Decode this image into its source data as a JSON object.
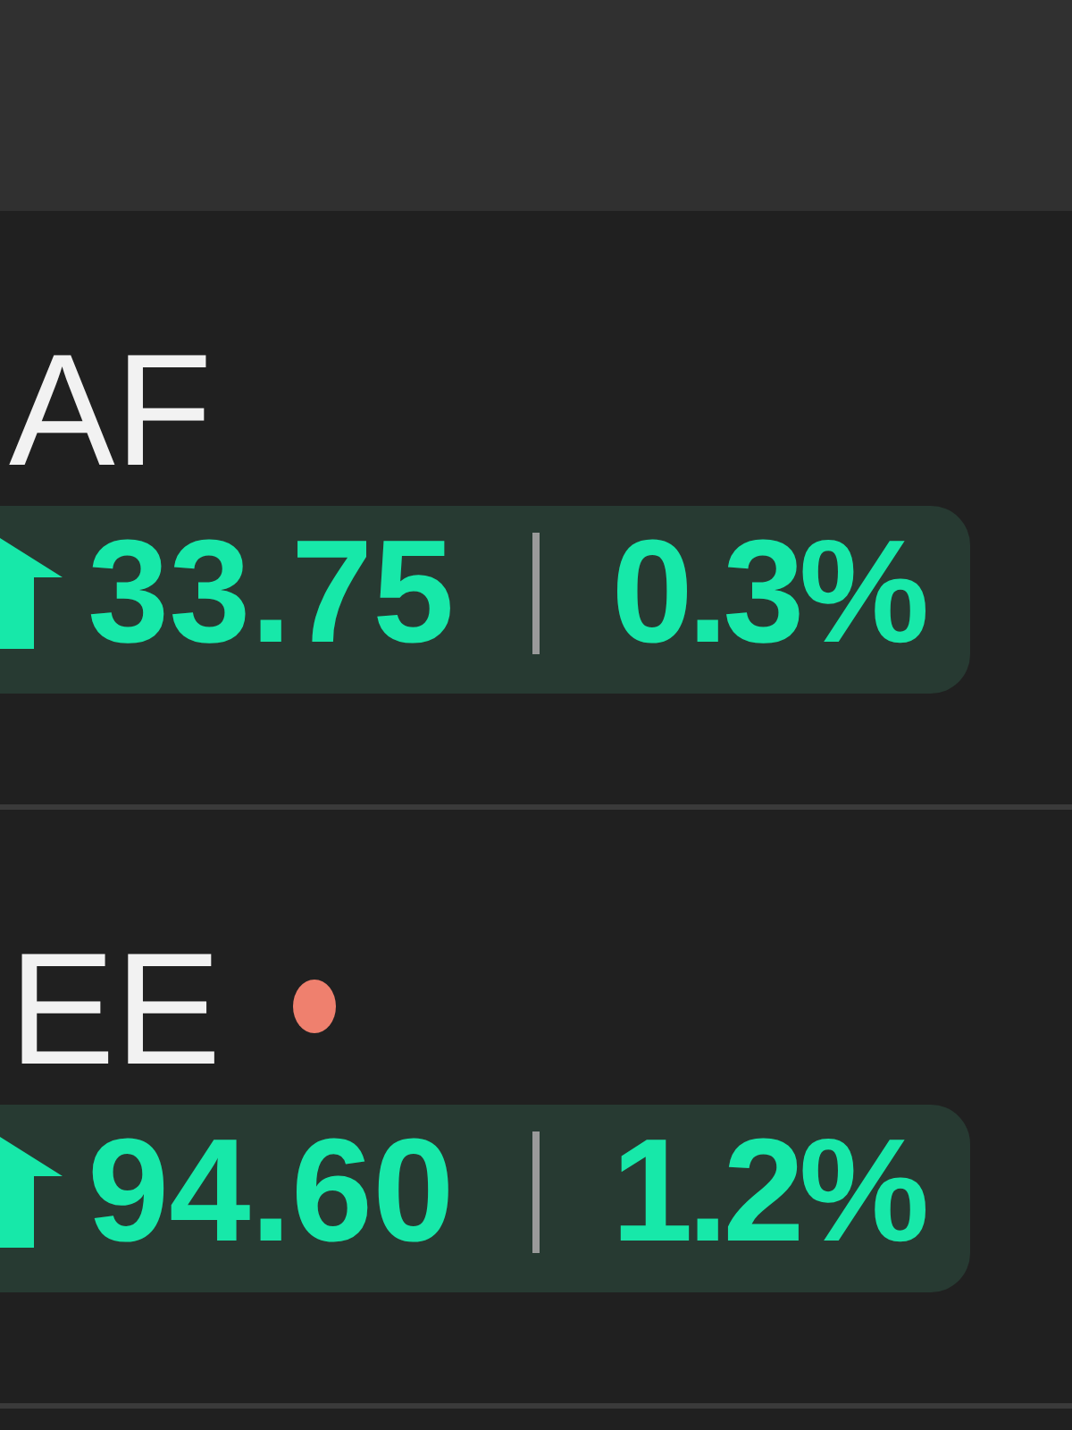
{
  "stocks": [
    {
      "ticker": "AF",
      "rising": true,
      "change": "33.75",
      "percent": "0.3%"
    },
    {
      "ticker": "EE",
      "color": "#ef806e",
      "rising": true,
      "change": "94.60",
      "percent": "1.2%"
    }
  ]
}
